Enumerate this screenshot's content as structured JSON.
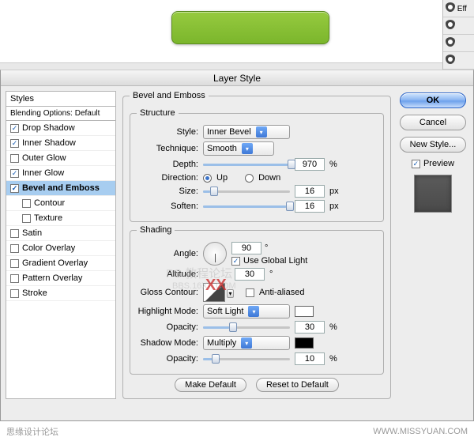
{
  "dialog_title": "Layer Style",
  "left_panel": {
    "styles_header": "Styles",
    "blending_header": "Blending Options: Default",
    "items": [
      {
        "label": "Drop Shadow",
        "checked": true,
        "indent": false,
        "selected": false
      },
      {
        "label": "Inner Shadow",
        "checked": true,
        "indent": false,
        "selected": false
      },
      {
        "label": "Outer Glow",
        "checked": false,
        "indent": false,
        "selected": false
      },
      {
        "label": "Inner Glow",
        "checked": true,
        "indent": false,
        "selected": false
      },
      {
        "label": "Bevel and Emboss",
        "checked": true,
        "indent": false,
        "selected": true
      },
      {
        "label": "Contour",
        "checked": false,
        "indent": true,
        "selected": false
      },
      {
        "label": "Texture",
        "checked": false,
        "indent": true,
        "selected": false
      },
      {
        "label": "Satin",
        "checked": false,
        "indent": false,
        "selected": false
      },
      {
        "label": "Color Overlay",
        "checked": false,
        "indent": false,
        "selected": false
      },
      {
        "label": "Gradient Overlay",
        "checked": false,
        "indent": false,
        "selected": false
      },
      {
        "label": "Pattern Overlay",
        "checked": false,
        "indent": false,
        "selected": false
      },
      {
        "label": "Stroke",
        "checked": false,
        "indent": false,
        "selected": false
      }
    ]
  },
  "group_title": "Bevel and Emboss",
  "structure": {
    "legend": "Structure",
    "style_label": "Style:",
    "style_value": "Inner Bevel",
    "technique_label": "Technique:",
    "technique_value": "Smooth",
    "depth_label": "Depth:",
    "depth_value": "970",
    "depth_unit": "%",
    "direction_label": "Direction:",
    "up_label": "Up",
    "down_label": "Down",
    "direction_value": "up",
    "size_label": "Size:",
    "size_value": "16",
    "size_unit": "px",
    "soften_label": "Soften:",
    "soften_value": "16",
    "soften_unit": "px"
  },
  "shading": {
    "legend": "Shading",
    "angle_label": "Angle:",
    "angle_value": "90",
    "angle_unit": "°",
    "global_light_label": "Use Global Light",
    "global_light_checked": true,
    "altitude_label": "Altitude:",
    "altitude_value": "30",
    "altitude_unit": "°",
    "gloss_label": "Gloss Contour:",
    "antialiased_label": "Anti-aliased",
    "antialiased_checked": false,
    "highlight_mode_label": "Highlight Mode:",
    "highlight_mode_value": "Soft Light",
    "highlight_color": "#ffffff",
    "highlight_opacity_label": "Opacity:",
    "highlight_opacity_value": "30",
    "highlight_opacity_unit": "%",
    "shadow_mode_label": "Shadow Mode:",
    "shadow_mode_value": "Multiply",
    "shadow_color": "#000000",
    "shadow_opacity_label": "Opacity:",
    "shadow_opacity_value": "10",
    "shadow_opacity_unit": "%"
  },
  "bottom": {
    "make_default": "Make Default",
    "reset_default": "Reset to Default"
  },
  "right": {
    "ok": "OK",
    "cancel": "Cancel",
    "new_style": "New Style...",
    "preview": "Preview",
    "preview_checked": true
  },
  "side_panel_label": "Eff",
  "watermark": {
    "xx": "XX",
    "line1": "PS 教程论坛",
    "line2": "BBS.16XX.COM"
  },
  "footer": {
    "left": "思缘设计论坛",
    "right": "WWW.MISSYUAN.COM"
  }
}
